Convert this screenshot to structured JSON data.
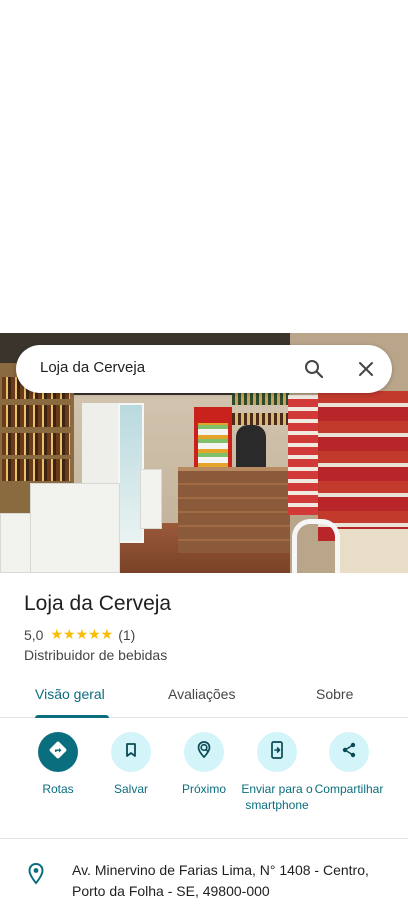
{
  "search": {
    "query": "Loja da Cerveja"
  },
  "place": {
    "name": "Loja da Cerveja",
    "rating": "5,0",
    "stars": "★★★★★",
    "review_count": "(1)",
    "category": "Distribuidor de bebidas",
    "address_line1": "Av. Minervino de Farias Lima, N° 1408 - Centro,",
    "address_line2": "Porto da Folha - SE, 49800-000"
  },
  "tabs": [
    {
      "label": "Visão geral",
      "active": true
    },
    {
      "label": "Avaliações",
      "active": false
    },
    {
      "label": "Sobre",
      "active": false
    }
  ],
  "actions": [
    {
      "label": "Rotas",
      "icon": "directions-icon"
    },
    {
      "label": "Salvar",
      "icon": "bookmark-icon"
    },
    {
      "label": "Próximo",
      "icon": "nearby-icon"
    },
    {
      "label": "Enviar para o smartphone",
      "icon": "send-to-phone-icon"
    },
    {
      "label": "Compartilhar",
      "icon": "share-icon"
    }
  ],
  "colors": {
    "accent": "#0b6e7f",
    "accent_light": "#d3f4f8",
    "star": "#fbbc04"
  }
}
